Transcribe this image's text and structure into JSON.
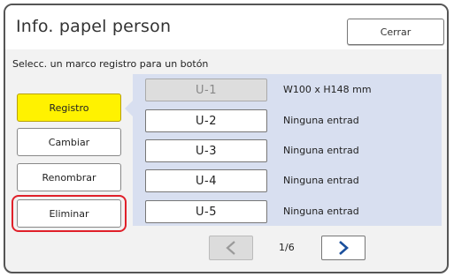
{
  "header": {
    "title": "Info. papel person",
    "close_label": "Cerrar"
  },
  "instruction": "Selecc. un marco registro para un botón",
  "actions": [
    {
      "label": "Registro",
      "active": true
    },
    {
      "label": "Cambiar",
      "active": false
    },
    {
      "label": "Renombrar",
      "active": false
    },
    {
      "label": "Eliminar",
      "active": false,
      "highlighted": true
    }
  ],
  "slots": [
    {
      "label": "U-1",
      "info": "W100 x H148 mm",
      "disabled": true
    },
    {
      "label": "U-2",
      "info": "Ninguna entrad",
      "disabled": false
    },
    {
      "label": "U-3",
      "info": "Ninguna entrad",
      "disabled": false
    },
    {
      "label": "U-4",
      "info": "Ninguna entrad",
      "disabled": false
    },
    {
      "label": "U-5",
      "info": "Ninguna entrad",
      "disabled": false
    }
  ],
  "pagination": {
    "indicator": "1/6",
    "prev_icon": "chevron-left-icon",
    "next_icon": "chevron-right-icon"
  },
  "colors": {
    "active_button": "#fff200",
    "panel": "#d8dff0",
    "highlight_ring": "#e0202a",
    "next_arrow": "#1b4f9c"
  }
}
